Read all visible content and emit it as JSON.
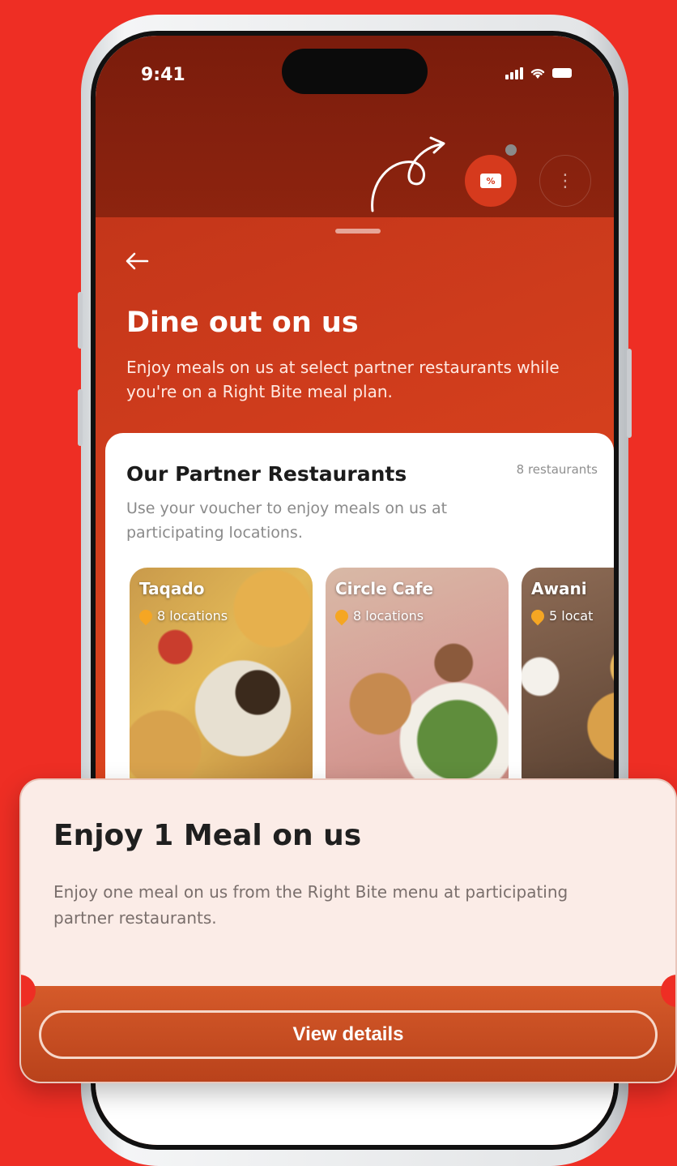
{
  "status_bar": {
    "time": "9:41"
  },
  "header": {
    "promo_icon": "voucher-percent-icon",
    "more_icon": "more-vertical-icon",
    "promo_tag": "%"
  },
  "sheet": {
    "title": "Dine out on us",
    "description": "Enjoy meals on us at select partner restaurants while you're on a Right Bite meal plan."
  },
  "partners": {
    "title": "Our Partner Restaurants",
    "count": "8 restaurants",
    "description": "Use your voucher to enjoy meals on us at participating locations.",
    "restaurants": [
      {
        "name": "Taqado",
        "locations": "8 locations"
      },
      {
        "name": "Circle Cafe",
        "locations": "8 locations"
      },
      {
        "name": "Awani",
        "locations": "5 locat"
      }
    ]
  },
  "voucher": {
    "title": "Enjoy 1 Meal on us",
    "description": "Enjoy one meal on us from the Right Bite menu at participating partner restaurants.",
    "button_label": "View details"
  },
  "colors": {
    "brand_red": "#ee2e24",
    "sheet_orange": "#d43f1d",
    "dark_header": "#7a1c0c",
    "pin": "#f5a623"
  }
}
